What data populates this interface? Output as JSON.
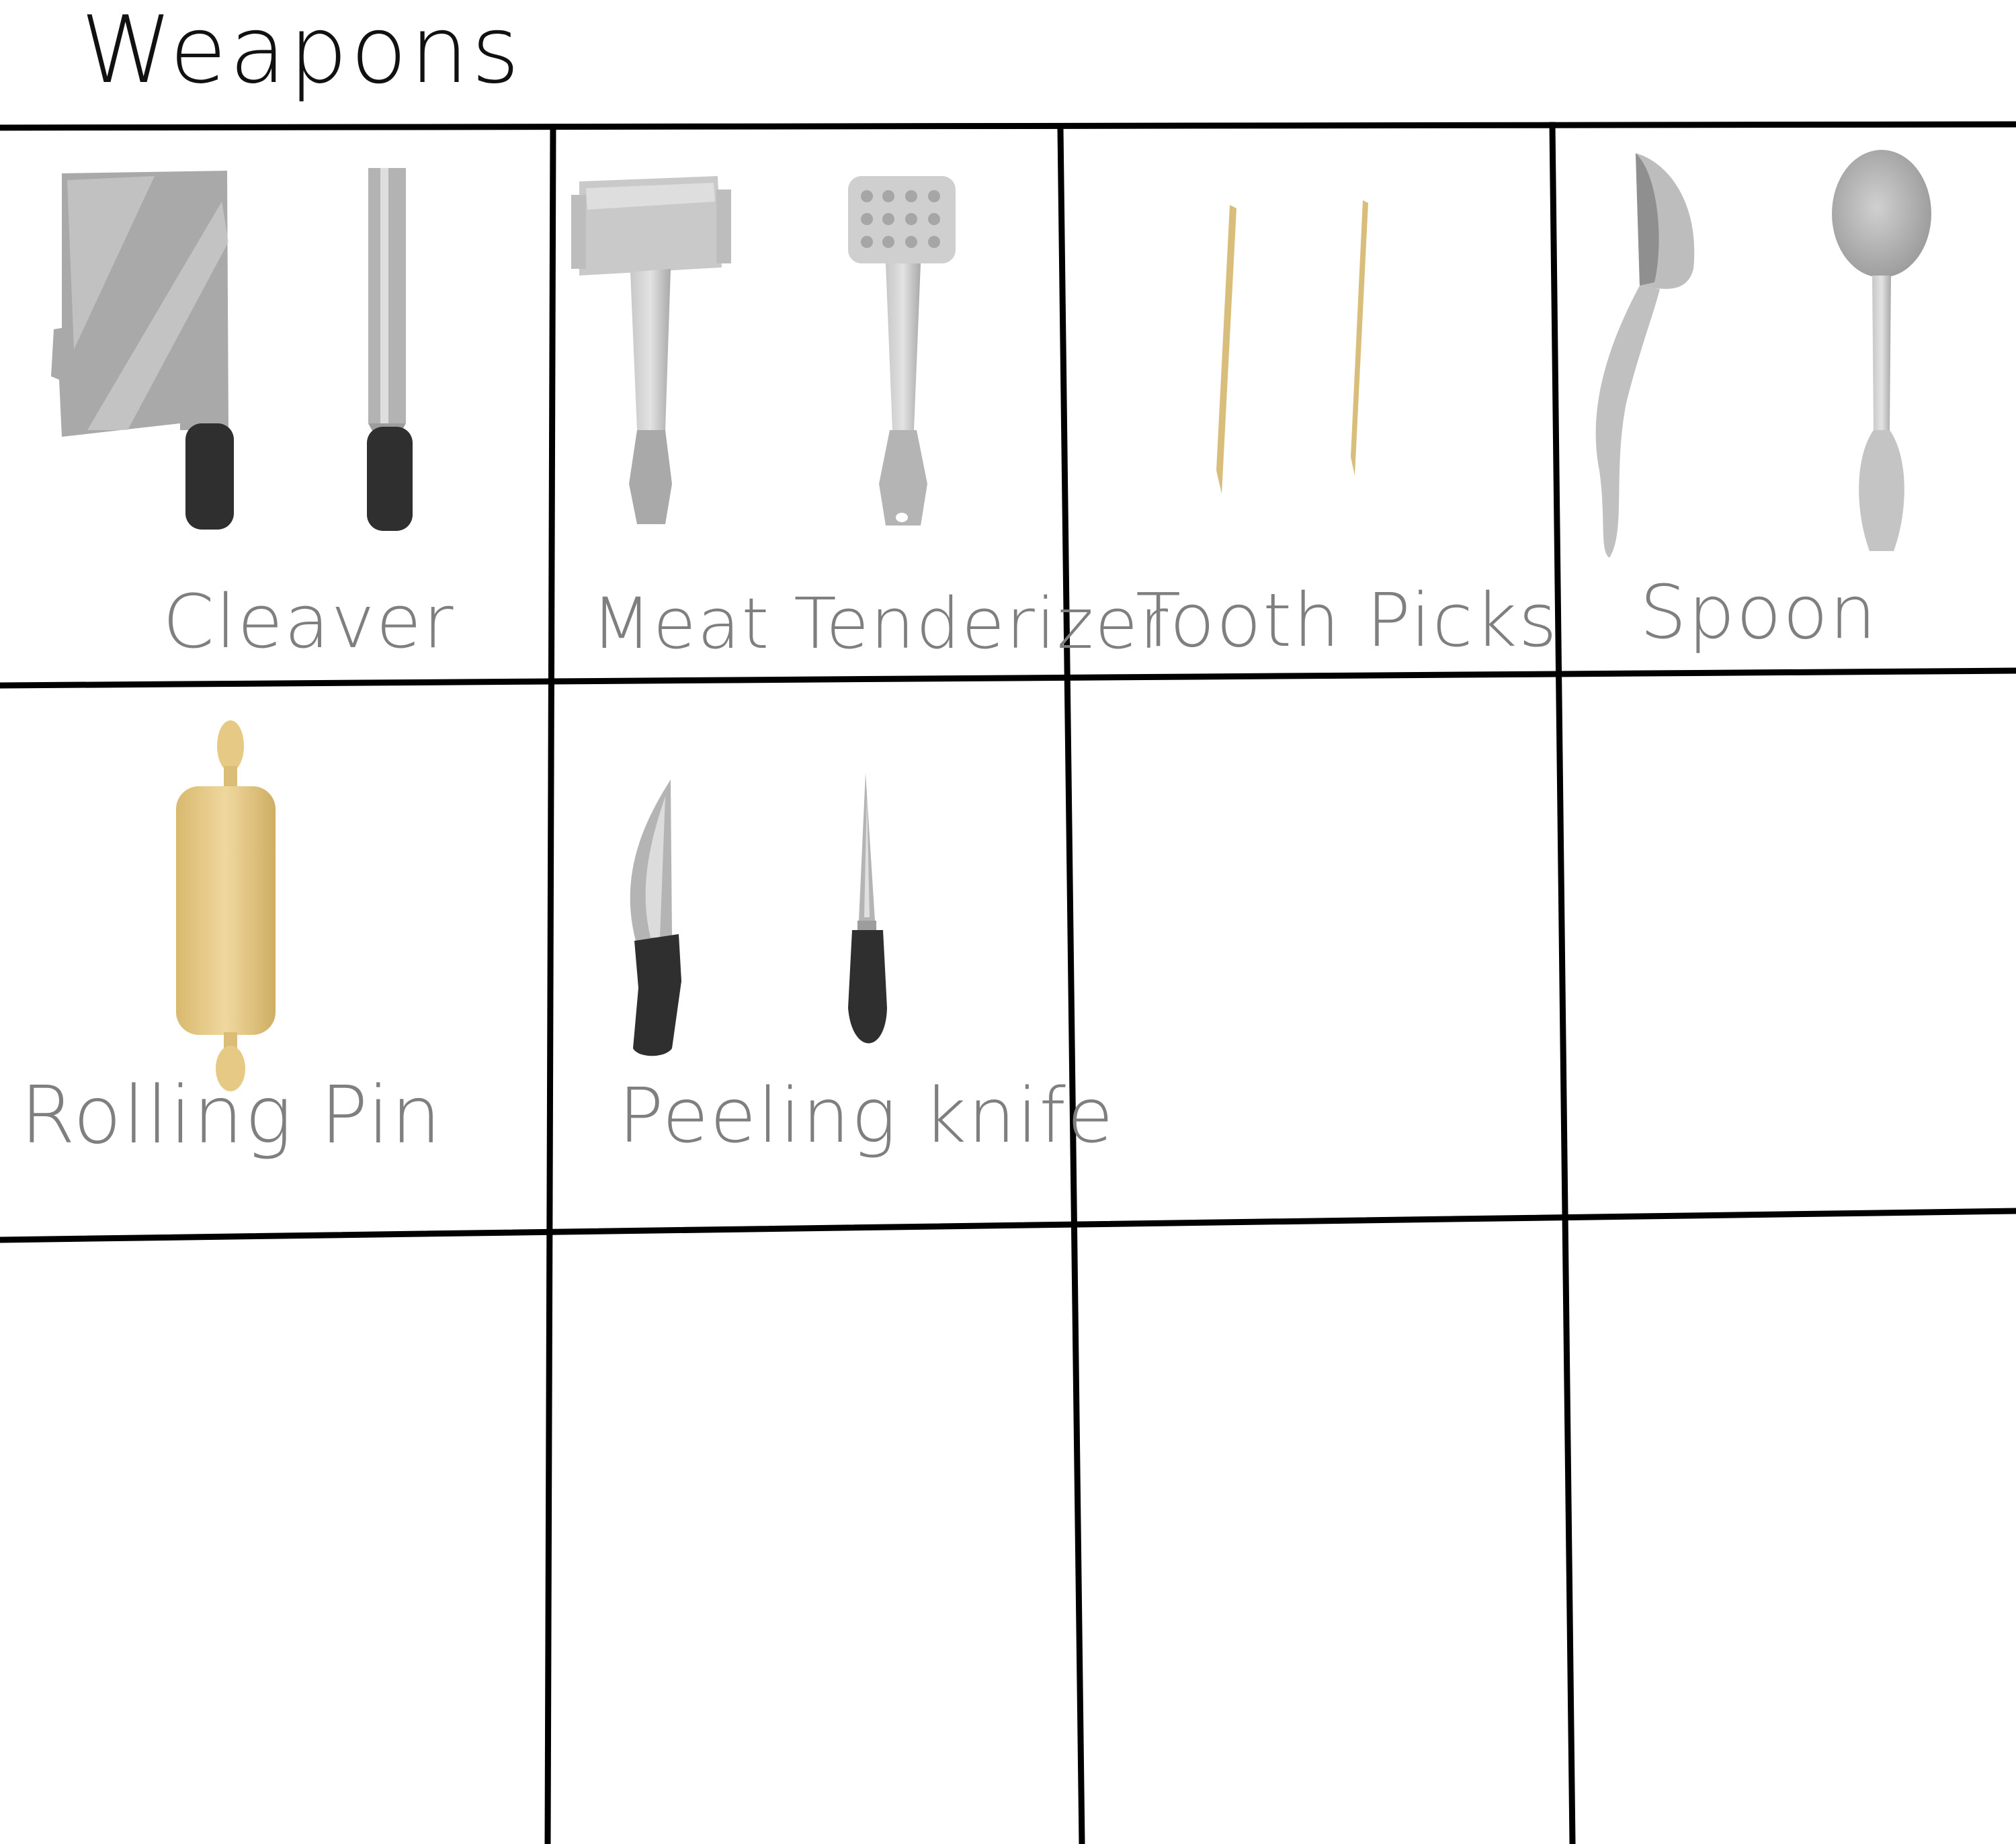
{
  "title": "Weapons",
  "colors": {
    "grid_line": "#000000",
    "label_text": "#7f7f7f",
    "metal": "#b5b5b5",
    "metal_light": "#d9d9d9",
    "handle": "#2f2f2f",
    "wood": "#e6c984"
  },
  "cells": [
    {
      "label": "Cleaver",
      "icons": [
        "cleaver-front-icon",
        "cleaver-side-icon"
      ]
    },
    {
      "label": "Meat Tenderizer",
      "icons": [
        "meat-tenderizer-side-icon",
        "meat-tenderizer-front-icon"
      ]
    },
    {
      "label": "Tooth Picks",
      "icons": [
        "toothpick-icon",
        "toothpick-icon"
      ]
    },
    {
      "label": "Spoon",
      "icons": [
        "spoon-side-icon",
        "spoon-front-icon"
      ]
    },
    {
      "label": "Rolling Pin",
      "icons": [
        "rolling-pin-icon"
      ]
    },
    {
      "label": "Peeling knife",
      "icons": [
        "peeling-knife-front-icon",
        "peeling-knife-side-icon"
      ]
    }
  ]
}
